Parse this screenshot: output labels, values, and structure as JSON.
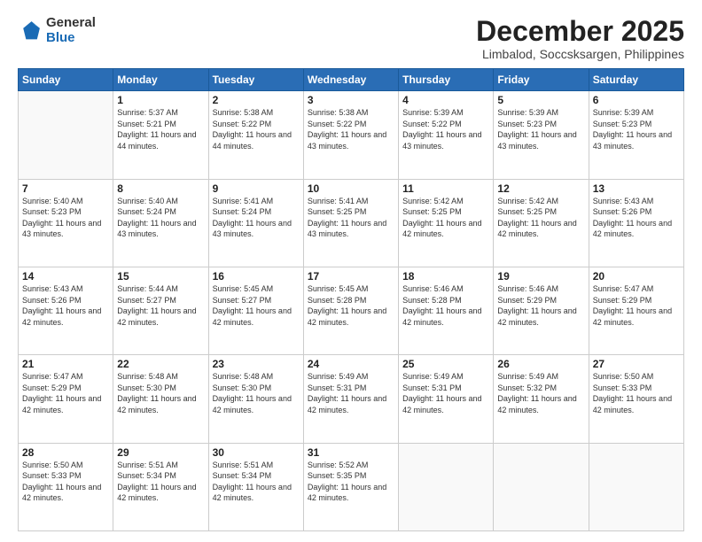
{
  "logo": {
    "general": "General",
    "blue": "Blue"
  },
  "header": {
    "title": "December 2025",
    "subtitle": "Limbalod, Soccsksargen, Philippines"
  },
  "weekdays": [
    "Sunday",
    "Monday",
    "Tuesday",
    "Wednesday",
    "Thursday",
    "Friday",
    "Saturday"
  ],
  "days": [
    {
      "num": "",
      "sunrise": "",
      "sunset": "",
      "daylight": ""
    },
    {
      "num": "1",
      "sunrise": "Sunrise: 5:37 AM",
      "sunset": "Sunset: 5:21 PM",
      "daylight": "Daylight: 11 hours and 44 minutes."
    },
    {
      "num": "2",
      "sunrise": "Sunrise: 5:38 AM",
      "sunset": "Sunset: 5:22 PM",
      "daylight": "Daylight: 11 hours and 44 minutes."
    },
    {
      "num": "3",
      "sunrise": "Sunrise: 5:38 AM",
      "sunset": "Sunset: 5:22 PM",
      "daylight": "Daylight: 11 hours and 43 minutes."
    },
    {
      "num": "4",
      "sunrise": "Sunrise: 5:39 AM",
      "sunset": "Sunset: 5:22 PM",
      "daylight": "Daylight: 11 hours and 43 minutes."
    },
    {
      "num": "5",
      "sunrise": "Sunrise: 5:39 AM",
      "sunset": "Sunset: 5:23 PM",
      "daylight": "Daylight: 11 hours and 43 minutes."
    },
    {
      "num": "6",
      "sunrise": "Sunrise: 5:39 AM",
      "sunset": "Sunset: 5:23 PM",
      "daylight": "Daylight: 11 hours and 43 minutes."
    },
    {
      "num": "7",
      "sunrise": "Sunrise: 5:40 AM",
      "sunset": "Sunset: 5:23 PM",
      "daylight": "Daylight: 11 hours and 43 minutes."
    },
    {
      "num": "8",
      "sunrise": "Sunrise: 5:40 AM",
      "sunset": "Sunset: 5:24 PM",
      "daylight": "Daylight: 11 hours and 43 minutes."
    },
    {
      "num": "9",
      "sunrise": "Sunrise: 5:41 AM",
      "sunset": "Sunset: 5:24 PM",
      "daylight": "Daylight: 11 hours and 43 minutes."
    },
    {
      "num": "10",
      "sunrise": "Sunrise: 5:41 AM",
      "sunset": "Sunset: 5:25 PM",
      "daylight": "Daylight: 11 hours and 43 minutes."
    },
    {
      "num": "11",
      "sunrise": "Sunrise: 5:42 AM",
      "sunset": "Sunset: 5:25 PM",
      "daylight": "Daylight: 11 hours and 42 minutes."
    },
    {
      "num": "12",
      "sunrise": "Sunrise: 5:42 AM",
      "sunset": "Sunset: 5:25 PM",
      "daylight": "Daylight: 11 hours and 42 minutes."
    },
    {
      "num": "13",
      "sunrise": "Sunrise: 5:43 AM",
      "sunset": "Sunset: 5:26 PM",
      "daylight": "Daylight: 11 hours and 42 minutes."
    },
    {
      "num": "14",
      "sunrise": "Sunrise: 5:43 AM",
      "sunset": "Sunset: 5:26 PM",
      "daylight": "Daylight: 11 hours and 42 minutes."
    },
    {
      "num": "15",
      "sunrise": "Sunrise: 5:44 AM",
      "sunset": "Sunset: 5:27 PM",
      "daylight": "Daylight: 11 hours and 42 minutes."
    },
    {
      "num": "16",
      "sunrise": "Sunrise: 5:45 AM",
      "sunset": "Sunset: 5:27 PM",
      "daylight": "Daylight: 11 hours and 42 minutes."
    },
    {
      "num": "17",
      "sunrise": "Sunrise: 5:45 AM",
      "sunset": "Sunset: 5:28 PM",
      "daylight": "Daylight: 11 hours and 42 minutes."
    },
    {
      "num": "18",
      "sunrise": "Sunrise: 5:46 AM",
      "sunset": "Sunset: 5:28 PM",
      "daylight": "Daylight: 11 hours and 42 minutes."
    },
    {
      "num": "19",
      "sunrise": "Sunrise: 5:46 AM",
      "sunset": "Sunset: 5:29 PM",
      "daylight": "Daylight: 11 hours and 42 minutes."
    },
    {
      "num": "20",
      "sunrise": "Sunrise: 5:47 AM",
      "sunset": "Sunset: 5:29 PM",
      "daylight": "Daylight: 11 hours and 42 minutes."
    },
    {
      "num": "21",
      "sunrise": "Sunrise: 5:47 AM",
      "sunset": "Sunset: 5:29 PM",
      "daylight": "Daylight: 11 hours and 42 minutes."
    },
    {
      "num": "22",
      "sunrise": "Sunrise: 5:48 AM",
      "sunset": "Sunset: 5:30 PM",
      "daylight": "Daylight: 11 hours and 42 minutes."
    },
    {
      "num": "23",
      "sunrise": "Sunrise: 5:48 AM",
      "sunset": "Sunset: 5:30 PM",
      "daylight": "Daylight: 11 hours and 42 minutes."
    },
    {
      "num": "24",
      "sunrise": "Sunrise: 5:49 AM",
      "sunset": "Sunset: 5:31 PM",
      "daylight": "Daylight: 11 hours and 42 minutes."
    },
    {
      "num": "25",
      "sunrise": "Sunrise: 5:49 AM",
      "sunset": "Sunset: 5:31 PM",
      "daylight": "Daylight: 11 hours and 42 minutes."
    },
    {
      "num": "26",
      "sunrise": "Sunrise: 5:49 AM",
      "sunset": "Sunset: 5:32 PM",
      "daylight": "Daylight: 11 hours and 42 minutes."
    },
    {
      "num": "27",
      "sunrise": "Sunrise: 5:50 AM",
      "sunset": "Sunset: 5:33 PM",
      "daylight": "Daylight: 11 hours and 42 minutes."
    },
    {
      "num": "28",
      "sunrise": "Sunrise: 5:50 AM",
      "sunset": "Sunset: 5:33 PM",
      "daylight": "Daylight: 11 hours and 42 minutes."
    },
    {
      "num": "29",
      "sunrise": "Sunrise: 5:51 AM",
      "sunset": "Sunset: 5:34 PM",
      "daylight": "Daylight: 11 hours and 42 minutes."
    },
    {
      "num": "30",
      "sunrise": "Sunrise: 5:51 AM",
      "sunset": "Sunset: 5:34 PM",
      "daylight": "Daylight: 11 hours and 42 minutes."
    },
    {
      "num": "31",
      "sunrise": "Sunrise: 5:52 AM",
      "sunset": "Sunset: 5:35 PM",
      "daylight": "Daylight: 11 hours and 42 minutes."
    },
    {
      "num": "",
      "sunrise": "",
      "sunset": "",
      "daylight": ""
    },
    {
      "num": "",
      "sunrise": "",
      "sunset": "",
      "daylight": ""
    },
    {
      "num": "",
      "sunrise": "",
      "sunset": "",
      "daylight": ""
    },
    {
      "num": "",
      "sunrise": "",
      "sunset": "",
      "daylight": ""
    }
  ]
}
